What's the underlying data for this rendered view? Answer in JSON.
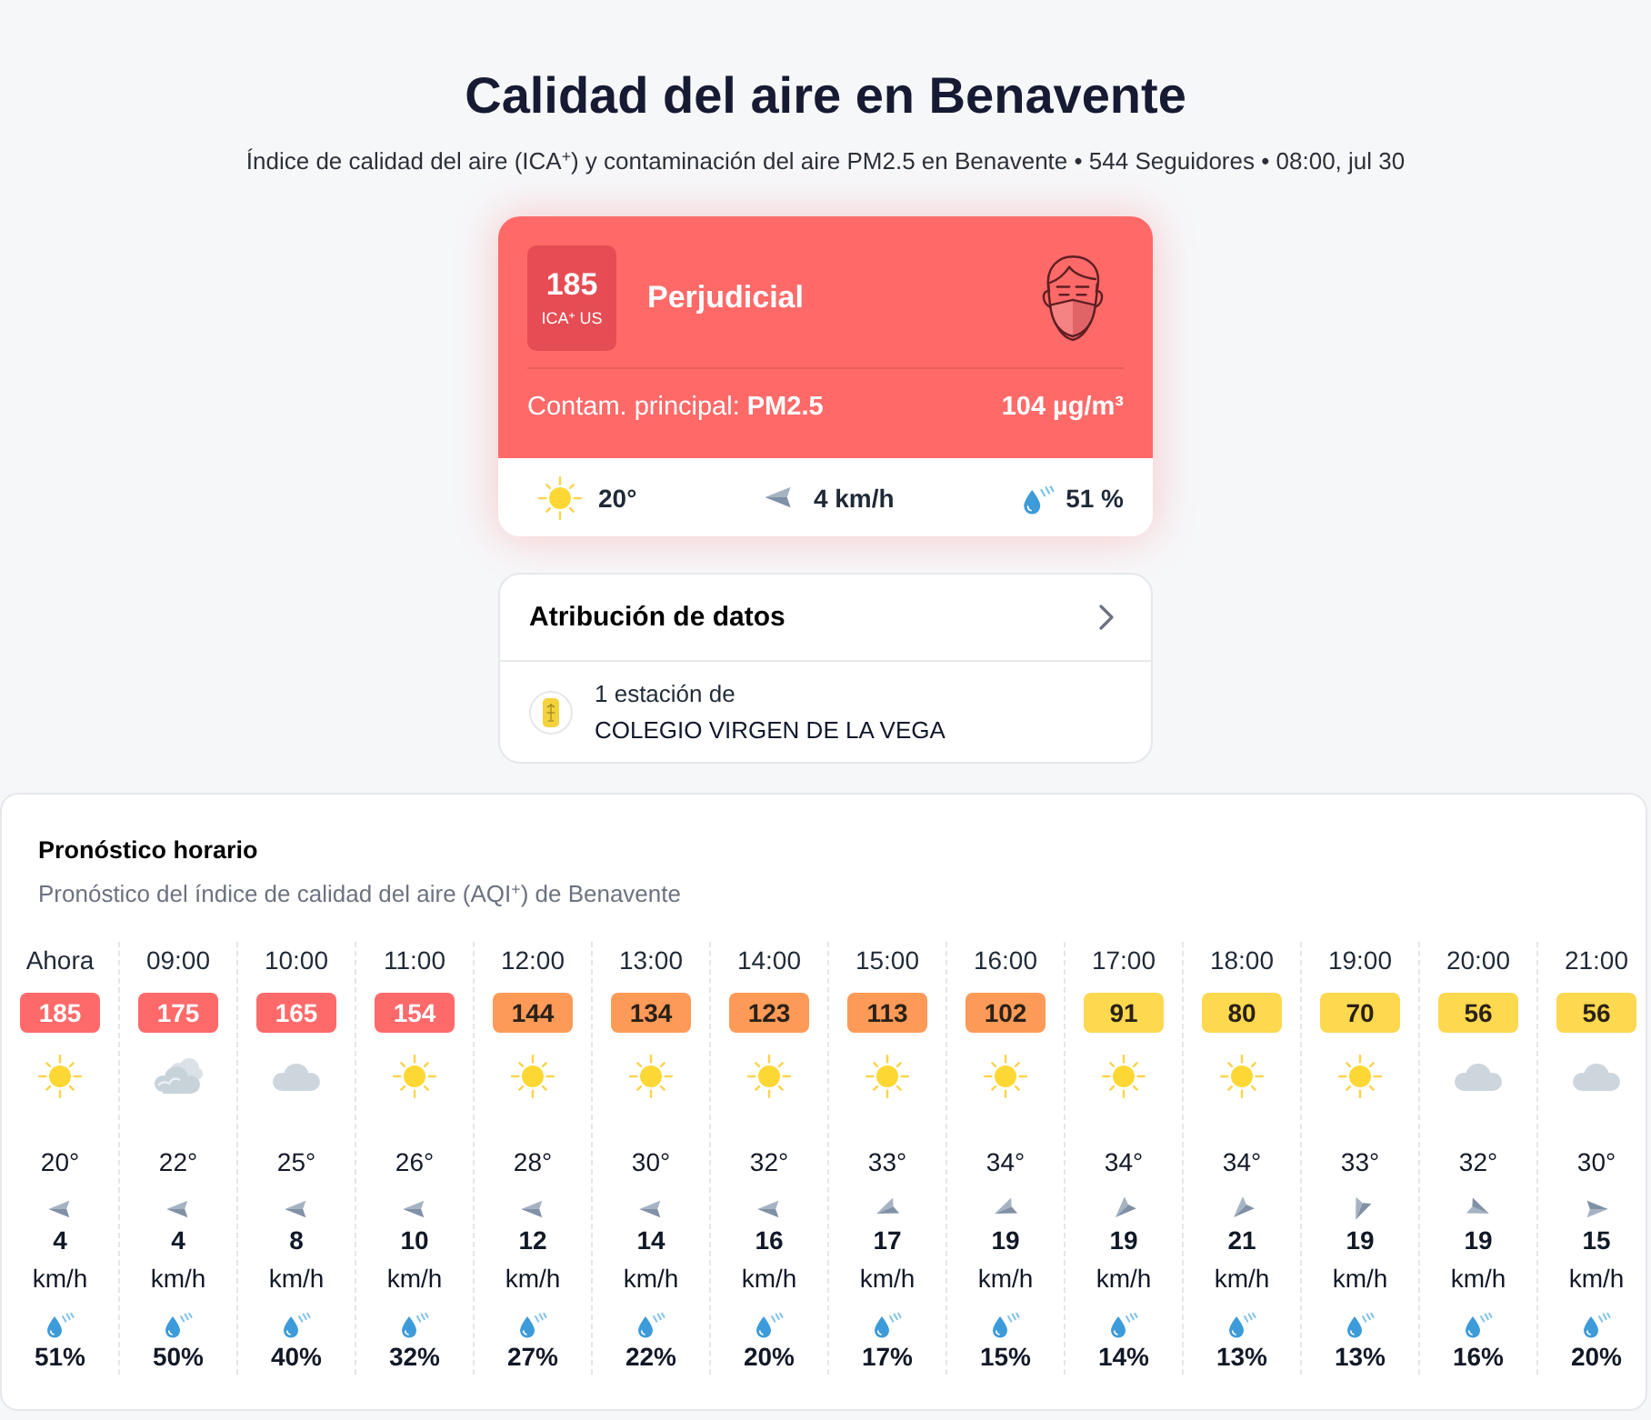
{
  "header": {
    "title": "Calidad del aire en Benavente",
    "subtitle": "Índice de calidad del aire (ICA$^{+}$) y contaminación del aire PM2.5 en Benavente • 544 Seguidores • 08:00, jul 30"
  },
  "aqi_card": {
    "value": "185",
    "scale": "ICA$^{+}$ US",
    "status": "Perjudicial",
    "pollutant": "Contam. principal: **PM2.5**",
    "concentration": "104 µg/m³",
    "weather": {
      "kind": "clear",
      "temperature": "20°",
      "wind": {
        "kind": "w",
        "speed": "4 km/h"
      },
      "humidity": "51 %"
    }
  },
  "attribution": {
    "title": "Atribución de datos",
    "station_count": "1 estación de",
    "station": "COLEGIO VIRGEN DE LA VEGA"
  },
  "forecast": {
    "title": "Pronóstico horario",
    "subtitle": "Pronóstico del índice de calidad del aire (AQI$^{+}$) de Benavente",
    "hours": [
      {
        "time": "Ahora",
        "aqi": "185",
        "color": "#fe6a6a",
        "kind": "clear",
        "temperature": "20°",
        "wind": {
          "kind": "w",
          "speed": "4",
          "unit": "km/h"
        },
        "humidity": "51%"
      },
      {
        "time": "09:00",
        "aqi": "175",
        "color": "#fe6a6a",
        "kind": "broken-clouds",
        "temperature": "22°",
        "wind": {
          "kind": "w",
          "speed": "4",
          "unit": "km/h"
        },
        "humidity": "50%"
      },
      {
        "time": "10:00",
        "aqi": "165",
        "color": "#fe6a6a",
        "kind": "clouds",
        "temperature": "25°",
        "wind": {
          "kind": "w",
          "speed": "8",
          "unit": "km/h"
        },
        "humidity": "40%"
      },
      {
        "time": "11:00",
        "aqi": "154",
        "color": "#fe6a6a",
        "kind": "clear",
        "temperature": "26°",
        "wind": {
          "kind": "w",
          "speed": "10",
          "unit": "km/h"
        },
        "humidity": "32%"
      },
      {
        "time": "12:00",
        "aqi": "144",
        "color": "#fe9a57",
        "kind": "clear",
        "temperature": "28°",
        "wind": {
          "kind": "w",
          "speed": "12",
          "unit": "km/h"
        },
        "humidity": "27%"
      },
      {
        "time": "13:00",
        "aqi": "134",
        "color": "#fe9a57",
        "kind": "clear",
        "temperature": "30°",
        "wind": {
          "kind": "w",
          "speed": "14",
          "unit": "km/h"
        },
        "humidity": "22%"
      },
      {
        "time": "14:00",
        "aqi": "123",
        "color": "#fe9a57",
        "kind": "clear",
        "temperature": "32°",
        "wind": {
          "kind": "w",
          "speed": "16",
          "unit": "km/h"
        },
        "humidity": "20%"
      },
      {
        "time": "15:00",
        "aqi": "113",
        "color": "#fe9a57",
        "kind": "clear",
        "temperature": "33°",
        "wind": {
          "kind": "wsw",
          "speed": "17",
          "unit": "km/h"
        },
        "humidity": "17%"
      },
      {
        "time": "16:00",
        "aqi": "102",
        "color": "#fe9a57",
        "kind": "clear",
        "temperature": "34°",
        "wind": {
          "kind": "wsw",
          "speed": "19",
          "unit": "km/h"
        },
        "humidity": "15%"
      },
      {
        "time": "17:00",
        "aqi": "91",
        "color": "#fed84f",
        "kind": "clear",
        "temperature": "34°",
        "wind": {
          "kind": "sw",
          "speed": "19",
          "unit": "km/h"
        },
        "humidity": "14%"
      },
      {
        "time": "18:00",
        "aqi": "80",
        "color": "#fed84f",
        "kind": "clear",
        "temperature": "34°",
        "wind": {
          "kind": "sw",
          "speed": "21",
          "unit": "km/h"
        },
        "humidity": "13%"
      },
      {
        "time": "19:00",
        "aqi": "70",
        "color": "#fed84f",
        "kind": "clear",
        "temperature": "33°",
        "wind": {
          "kind": "ssw",
          "speed": "19",
          "unit": "km/h"
        },
        "humidity": "13%"
      },
      {
        "time": "20:00",
        "aqi": "56",
        "color": "#fed84f",
        "kind": "clouds",
        "temperature": "32°",
        "wind": {
          "kind": "ese",
          "speed": "19",
          "unit": "km/h"
        },
        "humidity": "16%"
      },
      {
        "time": "21:00",
        "aqi": "56",
        "color": "#fed84f",
        "kind": "clouds",
        "temperature": "30°",
        "wind": {
          "kind": "e",
          "speed": "15",
          "unit": "km/h"
        },
        "humidity": "20%"
      }
    ]
  }
}
